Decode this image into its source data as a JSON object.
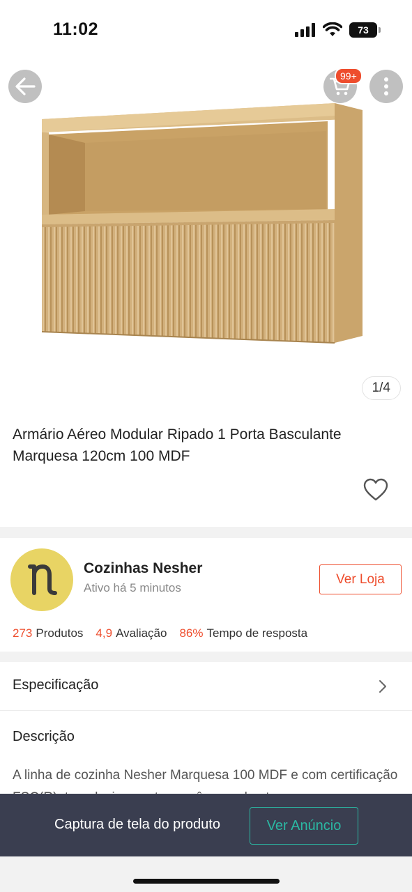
{
  "status_bar": {
    "time": "11:02",
    "battery_level": "73"
  },
  "header": {
    "cart_badge": "99+",
    "icons": [
      "back-arrow-icon",
      "cart-icon",
      "more-vertical-icon"
    ]
  },
  "gallery": {
    "counter": "1/4"
  },
  "product": {
    "title": "Armário Aéreo Modular Ripado 1 Porta Basculante Marquesa 120cm 100 MDF",
    "favorite_icon": "heart-outline-icon"
  },
  "store": {
    "avatar_letter": "n",
    "name": "Cozinhas Nesher",
    "status": "Ativo há 5 minutos",
    "visit_button": "Ver Loja",
    "stats": [
      {
        "value": "273",
        "label": "Produtos"
      },
      {
        "value": "4,9",
        "label": "Avaliação"
      },
      {
        "value": "86%",
        "label": "Tempo de resposta"
      }
    ]
  },
  "specification": {
    "label": "Especificação"
  },
  "description": {
    "heading": "Descrição",
    "text": "A linha de cozinha Nesher Marquesa 100 MDF e com certificação FSC(R), tem design contemporâneo, robusto"
  },
  "bottom_bar": {
    "text": "Captura de tela do produto",
    "button": "Ver Anúncio"
  },
  "colors": {
    "accent": "#ee4d2d",
    "teal": "#2bb8a3",
    "bottom_bar_bg": "#3a3e50",
    "avatar_bg": "#e8d464"
  }
}
